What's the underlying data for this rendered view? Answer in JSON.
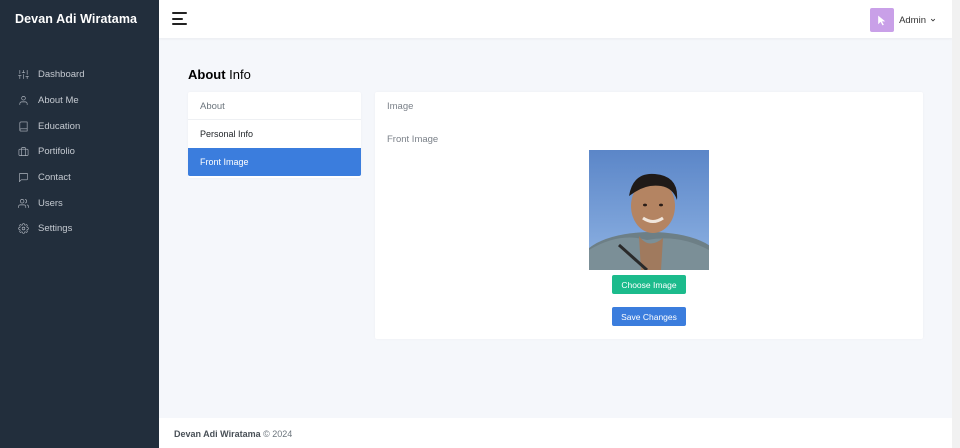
{
  "sidebar": {
    "brand": "Devan Adi Wiratama",
    "items": [
      {
        "label": "Dashboard",
        "icon": "sliders-icon"
      },
      {
        "label": "About Me",
        "icon": "user-icon"
      },
      {
        "label": "Education",
        "icon": "book-icon"
      },
      {
        "label": "Portifolio",
        "icon": "briefcase-icon"
      },
      {
        "label": "Contact",
        "icon": "message-square-icon"
      },
      {
        "label": "Users",
        "icon": "users-icon"
      },
      {
        "label": "Settings",
        "icon": "settings-icon"
      }
    ]
  },
  "topbar": {
    "user_name": "Admin",
    "avatar_color": "#c9a0e8"
  },
  "page": {
    "title_bold": "About",
    "title_rest": "Info"
  },
  "about_card": {
    "header": "About",
    "items": [
      {
        "label": "Personal Info",
        "active": false
      },
      {
        "label": "Front Image",
        "active": true
      }
    ]
  },
  "image_card": {
    "header": "Image",
    "field_label": "Front Image",
    "choose_button": "Choose Image",
    "save_button": "Save Changes"
  },
  "footer": {
    "name": "Devan Adi Wiratama",
    "copyright": "© 2024"
  },
  "colors": {
    "sidebar_bg": "#222e3c",
    "primary": "#3b7ddd",
    "success": "#1cbb8c"
  }
}
